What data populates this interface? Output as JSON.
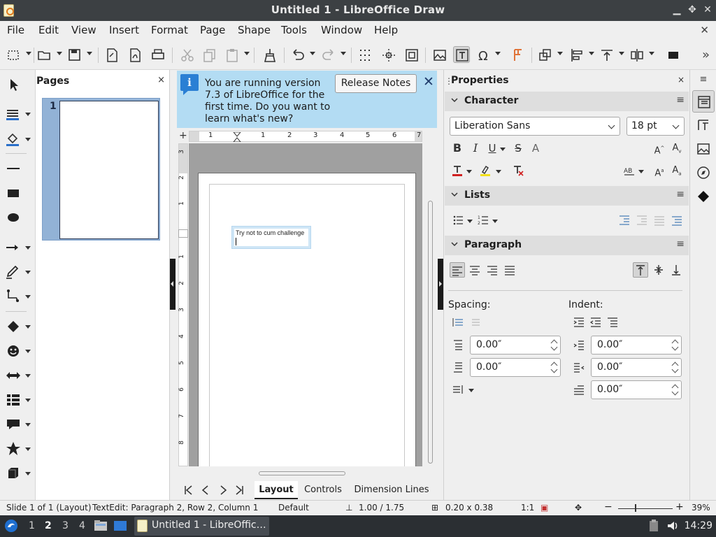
{
  "window": {
    "title": "Untitled 1 - LibreOffice Draw",
    "controls": [
      "minimize",
      "maximize",
      "close"
    ]
  },
  "menubar": {
    "items": [
      "File",
      "Edit",
      "View",
      "Insert",
      "Format",
      "Page",
      "Shape",
      "Tools",
      "Window",
      "Help"
    ],
    "close_label": "✕"
  },
  "toolbar": {
    "icons": [
      "select-icon",
      "open-icon",
      "save-icon",
      "export-icon",
      "export-pdf-icon",
      "print-icon",
      "cut-icon",
      "copy-icon",
      "paste-icon",
      "clone-formatting-icon",
      "undo-icon",
      "redo-icon",
      "grid-icon",
      "helplines-icon",
      "zoom-pan-icon",
      "image-icon",
      "textbox-icon",
      "special-character-icon",
      "fontwork-icon",
      "transformations-icon",
      "align-icon",
      "arrange-icon",
      "distribute-icon",
      "shadow-icon"
    ],
    "overflow": "»"
  },
  "pages_panel": {
    "title": "Pages",
    "close": "×",
    "page_number": "1"
  },
  "infobar": {
    "message": "You are running version 7.3 of LibreOffice for the first time. Do you want to learn what's new?",
    "button": "Release Notes",
    "close": "✕"
  },
  "ruler": {
    "h_numbers": [
      "1",
      "1",
      "2",
      "3",
      "4",
      "5",
      "6",
      "7"
    ],
    "v_numbers": [
      "3",
      "2",
      "1",
      "1",
      "2",
      "3",
      "4",
      "5",
      "6",
      "7",
      "8"
    ]
  },
  "canvas": {
    "textbox_text": "Try not to cum challenge"
  },
  "tabs": {
    "items": [
      "Layout",
      "Controls",
      "Dimension Lines"
    ],
    "active": "Layout"
  },
  "properties": {
    "title": "Properties",
    "close": "×",
    "character": {
      "label": "Character",
      "font_name": "Liberation Sans",
      "font_size": "18 pt"
    },
    "lists": {
      "label": "Lists"
    },
    "paragraph": {
      "label": "Paragraph",
      "spacing_label": "Spacing:",
      "indent_label": "Indent:",
      "spacing_above": "0.00″",
      "spacing_below": "0.00″",
      "indent_before": "0.00″",
      "indent_after": "0.00″",
      "indent_first": "0.00″"
    }
  },
  "statusbar": {
    "slide": "Slide 1 of 1 (Layout)",
    "edit": "TextEdit: Paragraph 2, Row 2, Column 1",
    "layer": "Default",
    "position": "1.00 / 1.75",
    "size": "0.20 x 0.38",
    "scale": "1:1",
    "zoom": "39%"
  },
  "taskbar": {
    "workspaces": [
      "1",
      "2",
      "3",
      "4"
    ],
    "active_workspace": "2",
    "task_label": "Untitled 1 - LibreOffic…",
    "clock": "14:29"
  },
  "colors": {
    "titlebar": "#3c4043",
    "infobar": "#b3dcf3",
    "selection": "#92b2d6",
    "taskbar": "#2b2f33"
  }
}
